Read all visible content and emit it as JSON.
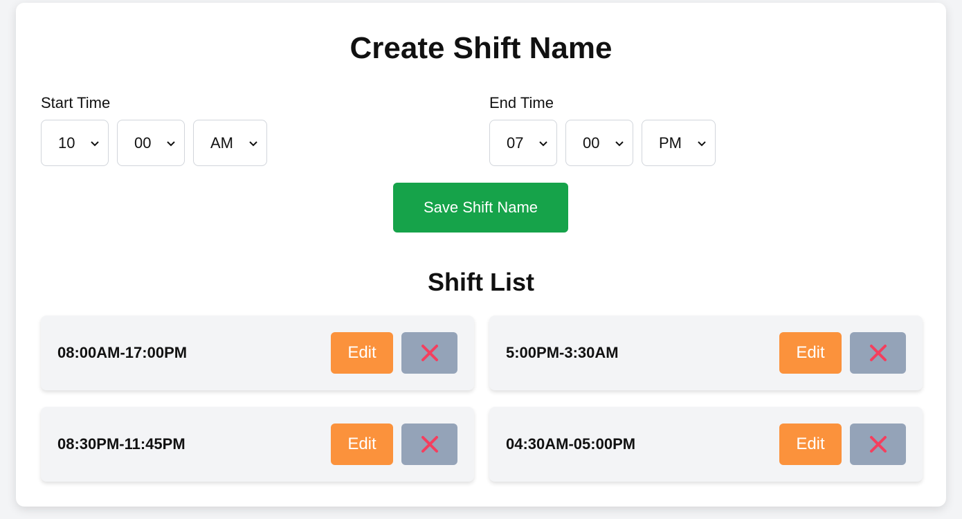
{
  "title": "Create Shift Name",
  "start": {
    "label": "Start Time",
    "hour": "10",
    "minute": "00",
    "period": "AM"
  },
  "end": {
    "label": "End Time",
    "hour": "07",
    "minute": "00",
    "period": "PM"
  },
  "save_label": "Save Shift Name",
  "list_title": "Shift List",
  "shifts": [
    {
      "label": "08:00AM-17:00PM",
      "edit": "Edit",
      "delete_icon": "x-icon"
    },
    {
      "label": "5:00PM-3:30AM",
      "edit": "Edit",
      "delete_icon": "x-icon"
    },
    {
      "label": "08:30PM-11:45PM",
      "edit": "Edit",
      "delete_icon": "x-icon"
    },
    {
      "label": "04:30AM-05:00PM",
      "edit": "Edit",
      "delete_icon": "x-icon"
    }
  ],
  "colors": {
    "save": "#16a34a",
    "edit": "#fb923c",
    "delete": "#94a3b8",
    "delete_icon": "#f43f5e",
    "item_bg": "#f3f4f6"
  }
}
